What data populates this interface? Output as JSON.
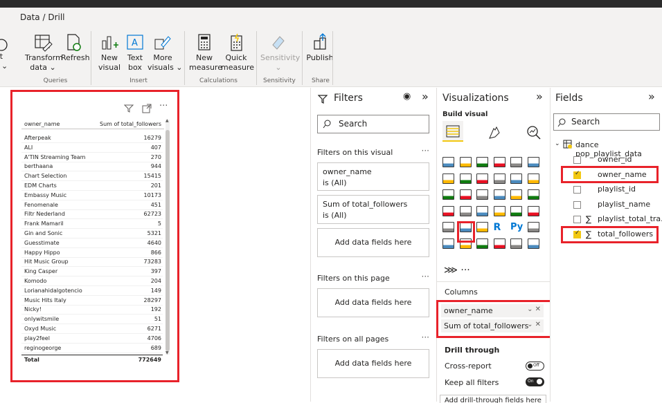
{
  "ribbon": {
    "active_tab": "Data / Drill",
    "buttons": [
      {
        "key": "new_element",
        "label": "ent\nes ⌄"
      },
      {
        "key": "transform",
        "label": "Transform\ndata ⌄"
      },
      {
        "key": "refresh",
        "label": "Refresh"
      },
      {
        "key": "new_visual",
        "label": "New\nvisual"
      },
      {
        "key": "text_box",
        "label": "Text\nbox"
      },
      {
        "key": "more_visuals",
        "label": "More\nvisuals ⌄"
      },
      {
        "key": "new_measure",
        "label": "New\nmeasure"
      },
      {
        "key": "quick_measure",
        "label": "Quick\nmeasure"
      },
      {
        "key": "sensitivity",
        "label": "Sensitivity\n⌄"
      },
      {
        "key": "publish",
        "label": "Publish"
      }
    ],
    "groups": [
      "Queries",
      "Insert",
      "Calculations",
      "Sensitivity",
      "Share"
    ]
  },
  "table": {
    "col1": "owner_name",
    "col2": "Sum of total_followers",
    "rows": [
      [
        "Afterpeak",
        "16279"
      ],
      [
        "ALI",
        "407"
      ],
      [
        "A'TIN Streaming Team",
        "270"
      ],
      [
        "berthaana",
        "944"
      ],
      [
        "Chart Selection",
        "15415"
      ],
      [
        "EDM Charts",
        "201"
      ],
      [
        "Embassy Music",
        "10173"
      ],
      [
        "Fenomenale",
        "451"
      ],
      [
        "Filtr Nederland",
        "62723"
      ],
      [
        "Frank Mamaril",
        "5"
      ],
      [
        "Gin and Sonic",
        "5321"
      ],
      [
        "Guesstimate",
        "4640"
      ],
      [
        "Happy Hippo",
        "866"
      ],
      [
        "Hit Music Group",
        "73283"
      ],
      [
        "King Casper",
        "397"
      ],
      [
        "Komodo",
        "204"
      ],
      [
        "Lorianahidalgotencio",
        "149"
      ],
      [
        "Music Hits Italy",
        "28297"
      ],
      [
        "Nicky!",
        "192"
      ],
      [
        "onlywitsmile",
        "51"
      ],
      [
        "Oxyd Music",
        "6271"
      ],
      [
        "play2feel",
        "4706"
      ],
      [
        "reginogeorge",
        "689"
      ]
    ],
    "total_label": "Total",
    "total_value": "772649"
  },
  "filters": {
    "title": "Filters",
    "search_placeholder": "Search",
    "on_visual": "Filters on this visual",
    "card1_title": "owner_name",
    "card1_sub": "is (All)",
    "card2_title": "Sum of total_followers",
    "card2_sub": "is (All)",
    "add_fields": "Add data fields here",
    "on_page": "Filters on this page",
    "on_all": "Filters on all pages"
  },
  "viz": {
    "title": "Visualizations",
    "build": "Build visual",
    "columns_label": "Columns",
    "chip1": "owner_name",
    "chip2": "Sum of total_followers",
    "drill": "Drill through",
    "cross_report": "Cross-report",
    "cross_state": "Off",
    "keep_filters": "Keep all filters",
    "keep_state": "On",
    "add_drill": "Add drill-through fields here"
  },
  "fields": {
    "title": "Fields",
    "search_placeholder": "Search",
    "table_name": "dance pop_playlist_data",
    "items": [
      {
        "label": "owner_id",
        "checked": false,
        "sigma": false
      },
      {
        "label": "owner_name",
        "checked": true,
        "sigma": false
      },
      {
        "label": "playlist_id",
        "checked": false,
        "sigma": false
      },
      {
        "label": "playlist_name",
        "checked": false,
        "sigma": false
      },
      {
        "label": "playlist_total_tra...",
        "checked": false,
        "sigma": true
      },
      {
        "label": "total_followers",
        "checked": true,
        "sigma": true
      }
    ]
  },
  "colors": {
    "highlight": "#e8222a",
    "accent": "#f2c811",
    "toggle": "#252423"
  }
}
